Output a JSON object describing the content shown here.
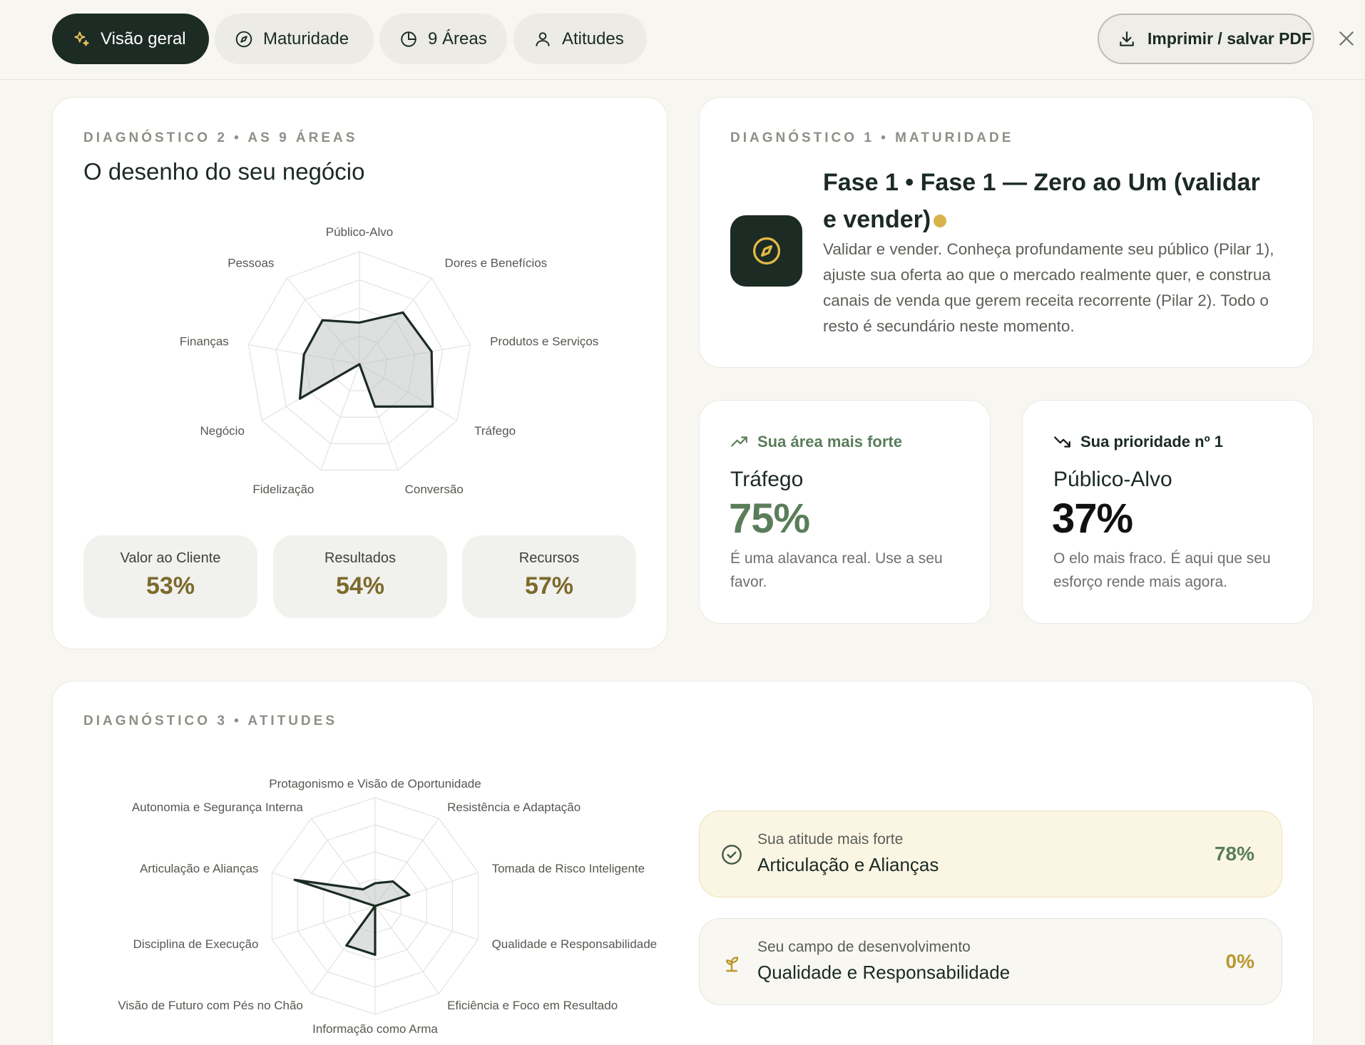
{
  "tabs": [
    {
      "label": "Visão geral",
      "icon": "sparkles-icon",
      "active": true
    },
    {
      "label": "Maturidade",
      "icon": "compass-icon",
      "active": false
    },
    {
      "label": "9 Áreas",
      "icon": "pie-chart-icon",
      "active": false
    },
    {
      "label": "Atitudes",
      "icon": "user-icon",
      "active": false
    }
  ],
  "toolbar": {
    "print_label": "Imprimir / salvar PDF",
    "print_icon": "download-icon",
    "close_icon": "close-icon"
  },
  "areas": {
    "eyebrow": "DIAGNÓSTICO 2 • AS 9 ÁREAS",
    "title": "O desenho do seu negócio",
    "pillars": [
      {
        "label": "Valor ao Cliente",
        "value": "53%"
      },
      {
        "label": "Resultados",
        "value": "54%"
      },
      {
        "label": "Recursos",
        "value": "57%"
      }
    ]
  },
  "maturity": {
    "eyebrow": "DIAGNÓSTICO 1 • MATURIDADE",
    "icon": "compass-icon",
    "title": "Fase 1 • Fase 1 — Zero ao Um (validar e vender)",
    "description": "Validar e vender. Conheça profundamente seu público (Pilar 1), ajuste sua oferta ao que o mercado realmente quer, e construa canais de venda que gerem receita recorrente (Pilar 2). Todo o resto é secundário neste momento."
  },
  "strongest": {
    "heading": "Sua área mais forte",
    "icon": "trending-up-icon",
    "area": "Tráfego",
    "value": "75%",
    "note": "É uma alavanca real. Use a seu favor.",
    "color": "#5a7d5a"
  },
  "priority": {
    "heading": "Sua prioridade nº 1",
    "icon": "trending-down-icon",
    "area": "Público-Alvo",
    "value": "37%",
    "note": "O elo mais fraco. É aqui que seu esforço rende mais agora.",
    "color": "#111111"
  },
  "attitudes": {
    "eyebrow": "DIAGNÓSTICO 3 • ATITUDES",
    "strongest": {
      "sub": "Sua atitude mais forte",
      "name": "Articulação e Alianças",
      "value": "78%",
      "icon": "check-circle-icon",
      "color": "#5a7d5a"
    },
    "development": {
      "sub": "Seu campo de desenvolvimento",
      "name": "Qualidade e Responsabilidade",
      "value": "0%",
      "icon": "sprout-icon",
      "color": "#b8982e"
    }
  },
  "chart_data": [
    {
      "type": "radar",
      "categories": [
        "Público-Alvo",
        "Dores e Benefícios",
        "Produtos e Serviços",
        "Tráfego",
        "Conversão",
        "Fidelização",
        "Negócio",
        "Finanças",
        "Pessoas"
      ],
      "values": [
        37,
        60,
        65,
        75,
        40,
        0,
        61,
        50,
        51
      ],
      "ylim": [
        0,
        100
      ],
      "grid": true
    },
    {
      "type": "radar",
      "categories": [
        "Protagonismo e Visão de Oportunidade",
        "Resistência e Adaptação",
        "Tomada de Risco Inteligente",
        "Qualidade e Responsabilidade",
        "Eficiência e Foco em Resultado",
        "Informação como Arma",
        "Visão de Futuro com Pés no Chão",
        "Disciplina de Execução",
        "Articulação e Alianças",
        "Autonomia e Segurança Interna"
      ],
      "values": [
        21,
        28,
        33,
        0,
        0,
        45,
        45,
        0,
        78,
        19
      ],
      "ylim": [
        0,
        100
      ],
      "grid": true
    }
  ]
}
